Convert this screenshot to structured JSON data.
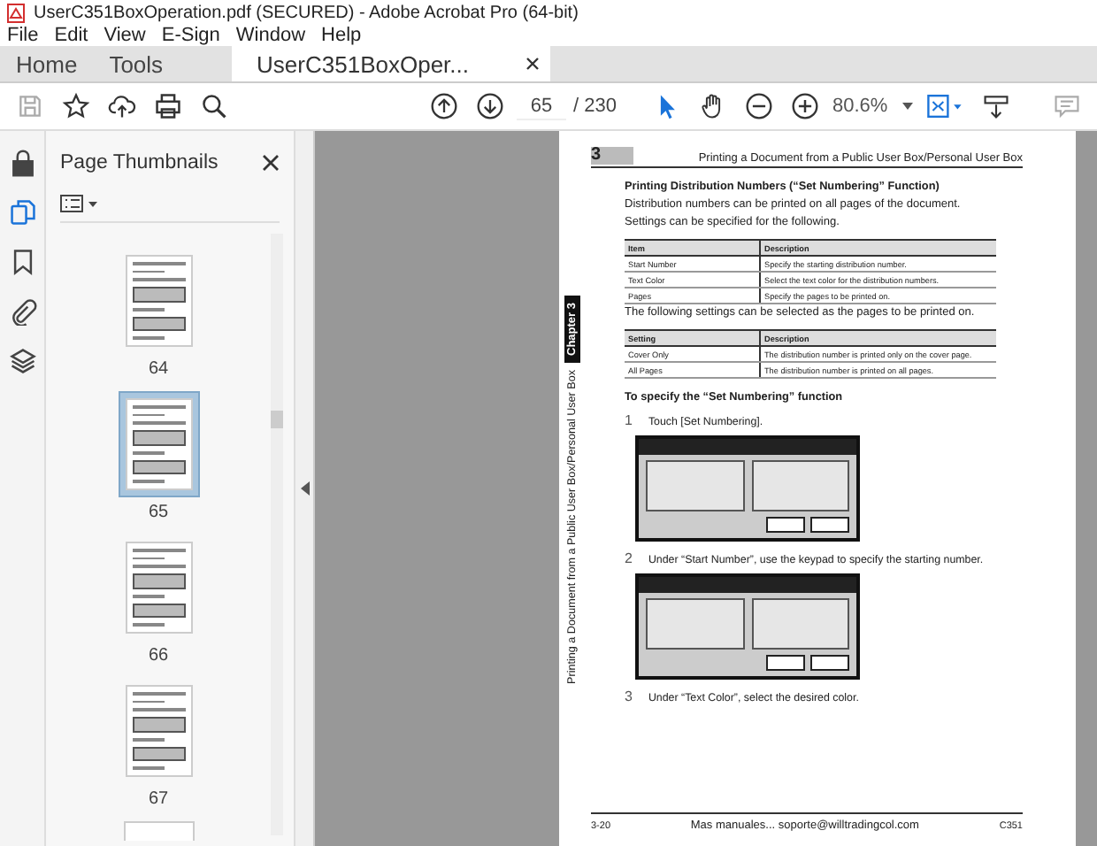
{
  "window": {
    "title": "UserC351BoxOperation.pdf (SECURED) - Adobe Acrobat Pro (64-bit)"
  },
  "menu": [
    "File",
    "Edit",
    "View",
    "E-Sign",
    "Window",
    "Help"
  ],
  "tabs": [
    {
      "label": "Home",
      "selected": false,
      "closable": false
    },
    {
      "label": "Tools",
      "selected": false,
      "closable": false
    },
    {
      "label": "UserC351BoxOper...",
      "selected": true,
      "closable": true
    }
  ],
  "toolbar": {
    "page": "65",
    "page_total": "/ 230",
    "zoom": "80.6%"
  },
  "rail": [
    {
      "selected": false
    },
    {
      "selected": true
    },
    {
      "selected": false
    },
    {
      "selected": false
    },
    {
      "selected": false
    }
  ],
  "sidebar": {
    "title": "Page Thumbnails",
    "thumbnails": [
      {
        "label": "64",
        "selected": false
      },
      {
        "label": "65",
        "selected": true
      },
      {
        "label": "66",
        "selected": false
      },
      {
        "label": "67",
        "selected": false
      }
    ]
  },
  "document": {
    "header_number": "3",
    "header_title": "Printing a Document from a Public User Box/Personal User Box",
    "side_tab": {
      "chapter": "Chapter 3",
      "text": "Printing a Document from a Public User Box/Personal User Box"
    },
    "section_title": "Printing Distribution Numbers (“Set Numbering” Function)",
    "paragraphs": [
      "Distribution numbers can be printed on all pages of the document.",
      "Settings can be specified for the following."
    ],
    "table_1": {
      "columns": [
        "Item",
        "Description"
      ],
      "rows": [
        [
          "Start Number",
          "Specify the starting distribution number."
        ],
        [
          "Text Color",
          "Select the text color for the distribution numbers."
        ],
        [
          "Pages",
          "Specify the pages to be printed on."
        ]
      ]
    },
    "note": "The following settings can be selected as the pages to be printed on.",
    "table_2": {
      "columns": [
        "Setting",
        "Description"
      ],
      "rows": [
        [
          "Cover Only",
          "The distribution number is printed only on the cover page."
        ],
        [
          "All Pages",
          "The distribution number is printed on all pages."
        ]
      ]
    },
    "subheading": "To specify the “Set Numbering” function",
    "steps": [
      {
        "number": "1",
        "text": "Touch [Set Numbering].",
        "screen": true
      },
      {
        "number": "2",
        "text": "Under “Start Number”, use the keypad to specify the starting number.",
        "screen": true
      },
      {
        "number": "3",
        "text": "Under “Text Color”, select the desired color.",
        "screen": false
      }
    ],
    "footer": {
      "page": "3-20",
      "center": "Mas manuales... soporte@willtradingcol.com",
      "model": "C351"
    }
  }
}
